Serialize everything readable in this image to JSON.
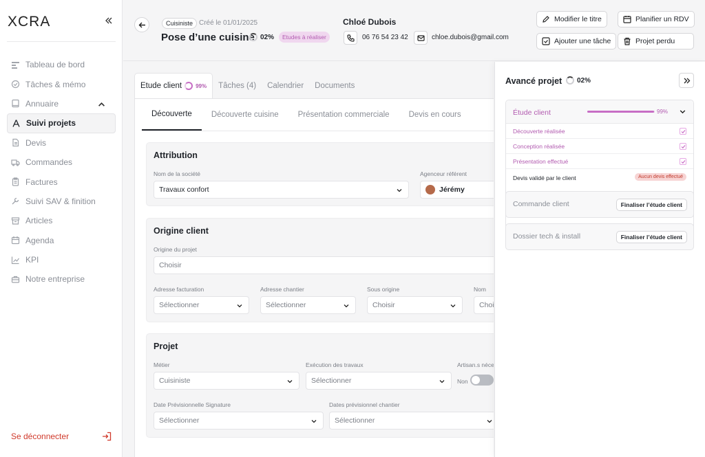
{
  "app": {
    "logo": "XCRA",
    "logout_label": "Se déconnecter"
  },
  "sidebar": {
    "items": [
      {
        "label": "Tableau de bord",
        "icon": "dashboard-icon"
      },
      {
        "label": "Tâches & mémo",
        "icon": "check-circle-icon"
      },
      {
        "label": "Annuaire",
        "icon": "book-icon"
      },
      {
        "label": "Suivi projets",
        "icon": "triangle-icon"
      },
      {
        "label": "Devis",
        "icon": "document-icon"
      },
      {
        "label": "Commandes",
        "icon": "truck-icon"
      },
      {
        "label": "Factures",
        "icon": "clipboard-icon"
      },
      {
        "label": "Suivi SAV & finition",
        "icon": "wrench-icon"
      },
      {
        "label": "Articles",
        "icon": "archive-icon"
      },
      {
        "label": "Agenda",
        "icon": "calendar-icon"
      },
      {
        "label": "KPI",
        "icon": "chart-icon"
      },
      {
        "label": "Notre entreprise",
        "icon": "briefcase-icon"
      }
    ],
    "active": "Suivi projets"
  },
  "header": {
    "tag": "Cuisiniste",
    "created": "Créé le 01/01/2025",
    "title": "Pose d’une cuisine",
    "progress": "02%",
    "status": "Etudes à réaliser",
    "client_name": "Chloé Dubois",
    "phone": "06 76 54 23 42",
    "email": "chloe.dubois@gmail.com",
    "buttons": {
      "edit_title": "Modifier le titre",
      "plan_rdv": "Planifier un RDV",
      "add_task": "Ajouter une tâche",
      "lost": "Projet perdu"
    }
  },
  "tabs": [
    {
      "label": "Etude client",
      "pct": "99%"
    },
    {
      "label": "Tâches (4)"
    },
    {
      "label": "Calendrier"
    },
    {
      "label": "Documents"
    }
  ],
  "subtabs": [
    "Découverte",
    "Découverte cuisine",
    "Présentation commerciale",
    "Devis en cours"
  ],
  "attribution": {
    "title": "Attribution",
    "company_label": "Nom de la société",
    "company_value": "Travaux confort",
    "agent_label": "Agenceur référent",
    "agent_value": "Jérémy"
  },
  "origine": {
    "title": "Origine client",
    "origin_label": "Origine du projet",
    "origin_placeholder": "Choisir",
    "billing_label": "Adresse facturation",
    "billing_placeholder": "Sélectionner",
    "site_label": "Adresse chantier",
    "site_placeholder": "Sélectionner",
    "sub_label": "Sous origine",
    "sub_placeholder": "Choisir",
    "name_label": "Nom",
    "name_placeholder": "Choisir"
  },
  "projet": {
    "title": "Projet",
    "metier_label": "Métier",
    "metier_value": "Cuisiniste",
    "execution_label": "Exécution des travaux",
    "execution_placeholder": "Sélectionner",
    "artisan_label": "Artisan.s nécessaire",
    "artisan_toggle": "Non",
    "toggle_value": false,
    "date_sign_label": "Date Prévisionnelle Signature",
    "date_sign_placeholder": "Sélectionner",
    "date_site_label": "Dates prévisionnel chantier",
    "date_site_placeholder": "Sélectionner"
  },
  "panel": {
    "title": "Avancé projet",
    "pct": "02%",
    "stages": [
      {
        "name": "Étude client",
        "pct": "99%",
        "progress": 0.99,
        "items": [
          {
            "label": "Découverte réalisée",
            "done": true
          },
          {
            "label": "Conception réalisée",
            "done": true
          },
          {
            "label": "Présentation effectué",
            "done": true
          },
          {
            "label": "Devis validé par le client",
            "badge": "Aucun devis effectué"
          }
        ]
      },
      {
        "name": "Commande client",
        "button": "Finaliser l’étude client"
      },
      {
        "name": "Dossier tech & install",
        "button": "Finaliser l’étude client"
      }
    ]
  },
  "colors": {
    "accent": "#c76dc5",
    "logout": "#d0392b",
    "badge_red": "#f7d4d4"
  }
}
